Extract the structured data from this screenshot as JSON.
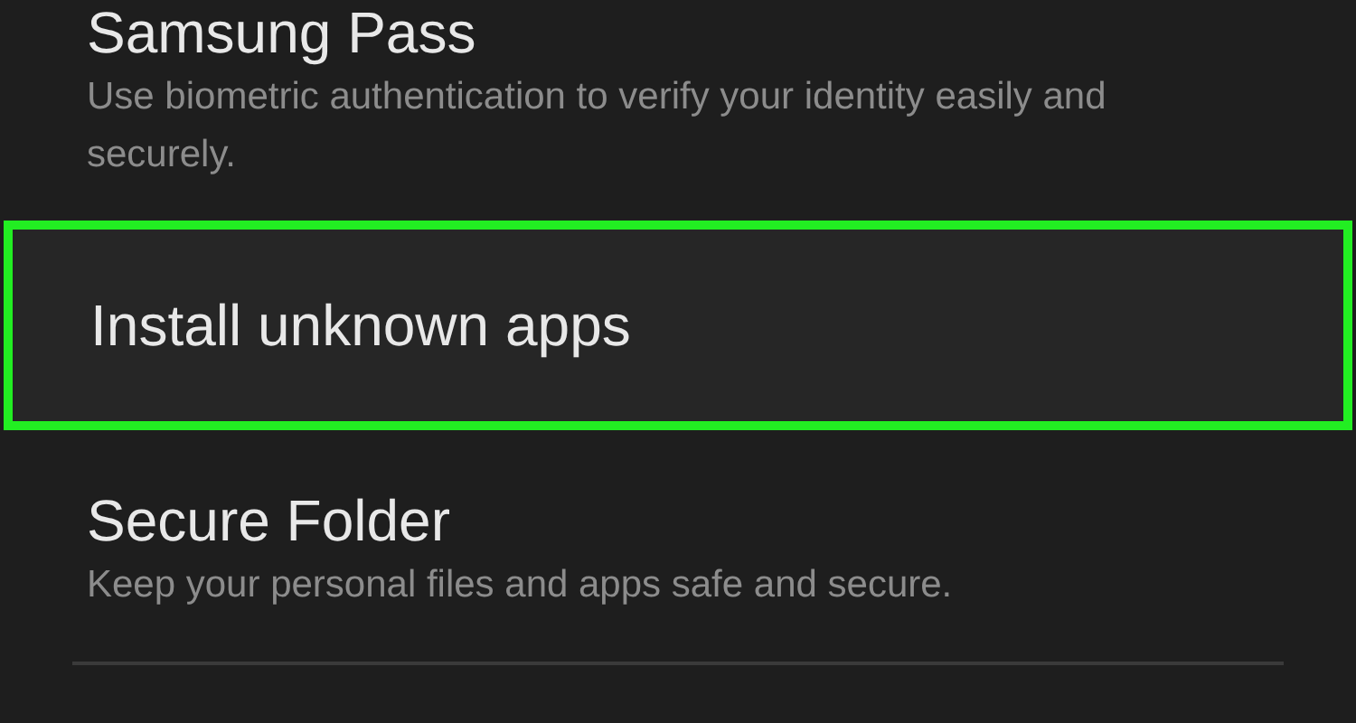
{
  "settings_items": [
    {
      "title": "Samsung Pass",
      "description": "Use biometric authentication to verify your identity easily and securely.",
      "highlighted": false
    },
    {
      "title": "Install unknown apps",
      "highlighted": true
    },
    {
      "title": "Secure Folder",
      "description": "Keep your personal files and apps safe and secure.",
      "highlighted": false
    }
  ]
}
